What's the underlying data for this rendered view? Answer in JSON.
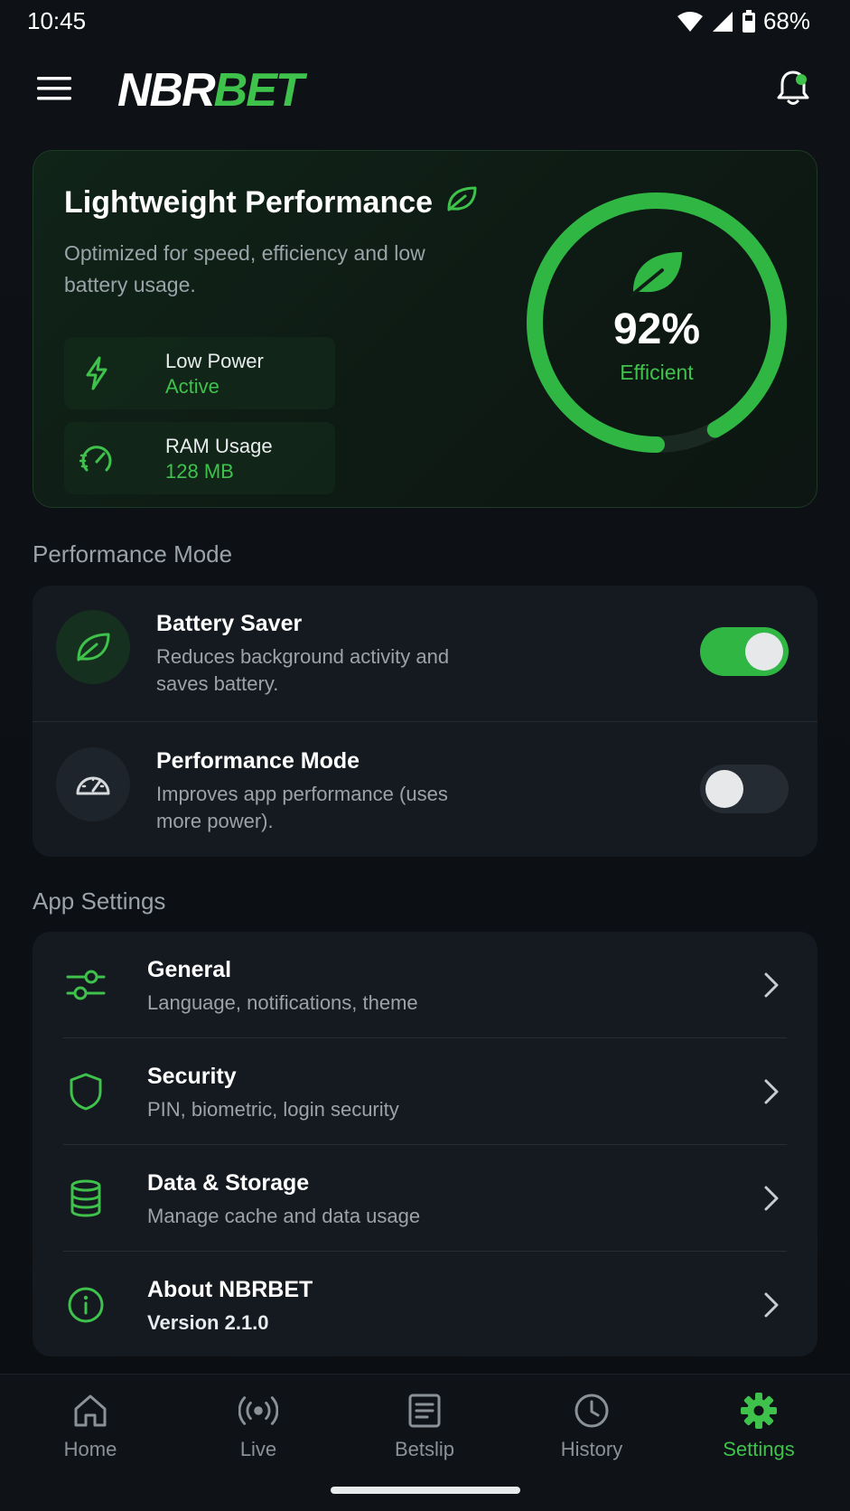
{
  "status_bar": {
    "time": "10:45",
    "battery": "68%",
    "icons": [
      "wifi-icon",
      "signal-icon",
      "battery-icon"
    ]
  },
  "header": {
    "logo_part1": "NBR",
    "logo_part2": "BET",
    "icons": [
      "hamburger-menu-icon",
      "bell-icon"
    ]
  },
  "hero": {
    "title": "Lightweight Performance",
    "subtitle": "Optimized for speed, efficiency and low battery usage.",
    "stats": [
      {
        "label": "Low Power",
        "value": "Active",
        "icon": "lightning-icon"
      },
      {
        "label": "RAM Usage",
        "value": "128 MB",
        "icon": "speedometer-icon"
      }
    ],
    "gauge": {
      "value_text": "92%",
      "label": "Efficient",
      "fraction": 0.92
    }
  },
  "performance_section": {
    "title": "Performance Mode",
    "rows": [
      {
        "title": "Battery Saver",
        "description": "Reduces background activity and saves battery.",
        "enabled": true,
        "icon": "leaf-icon"
      },
      {
        "title": "Performance Mode",
        "description": "Improves app performance (uses more power).",
        "enabled": false,
        "icon": "gauge-icon"
      }
    ]
  },
  "app_settings": {
    "title": "App Settings",
    "rows": [
      {
        "title": "General",
        "subtitle": "Language, notifications, theme",
        "icon": "sliders-icon"
      },
      {
        "title": "Security",
        "subtitle": "PIN, biometric, login security",
        "icon": "shield-icon"
      },
      {
        "title": "Data & Storage",
        "subtitle": "Manage cache and data usage",
        "icon": "database-icon"
      },
      {
        "title": "About NBRBET",
        "subtitle": "Version 2.1.0",
        "icon": "info-icon"
      }
    ]
  },
  "bottom_nav": {
    "items": [
      {
        "label": "Home",
        "icon": "home-icon"
      },
      {
        "label": "Live",
        "icon": "broadcast-icon"
      },
      {
        "label": "Betslip",
        "icon": "receipt-icon"
      },
      {
        "label": "History",
        "icon": "clock-icon"
      },
      {
        "label": "Settings",
        "icon": "gear-icon"
      }
    ],
    "active": "Settings"
  },
  "colors": {
    "accent": "#3fc24b",
    "background": "#0d1014",
    "card": "#151a20",
    "muted_text": "#9aa3a8"
  }
}
